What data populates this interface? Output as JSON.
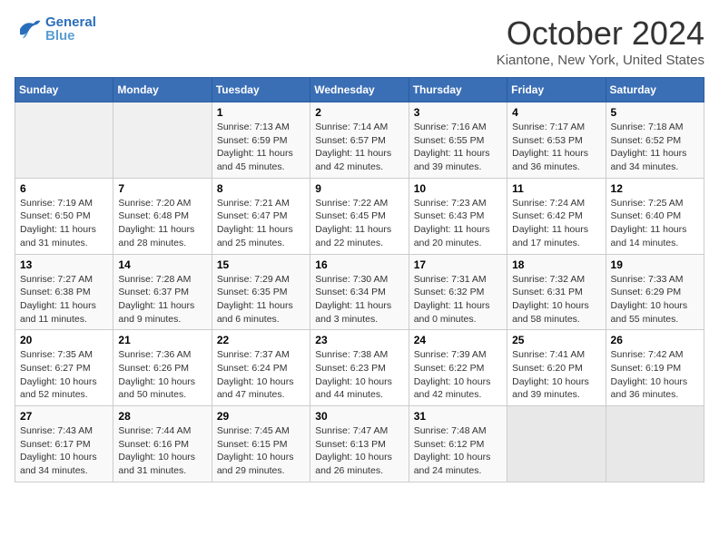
{
  "header": {
    "logo_line1": "General",
    "logo_line2": "Blue",
    "month": "October 2024",
    "location": "Kiantone, New York, United States"
  },
  "weekdays": [
    "Sunday",
    "Monday",
    "Tuesday",
    "Wednesday",
    "Thursday",
    "Friday",
    "Saturday"
  ],
  "weeks": [
    [
      {
        "day": "",
        "info": ""
      },
      {
        "day": "",
        "info": ""
      },
      {
        "day": "1",
        "info": "Sunrise: 7:13 AM\nSunset: 6:59 PM\nDaylight: 11 hours and 45 minutes."
      },
      {
        "day": "2",
        "info": "Sunrise: 7:14 AM\nSunset: 6:57 PM\nDaylight: 11 hours and 42 minutes."
      },
      {
        "day": "3",
        "info": "Sunrise: 7:16 AM\nSunset: 6:55 PM\nDaylight: 11 hours and 39 minutes."
      },
      {
        "day": "4",
        "info": "Sunrise: 7:17 AM\nSunset: 6:53 PM\nDaylight: 11 hours and 36 minutes."
      },
      {
        "day": "5",
        "info": "Sunrise: 7:18 AM\nSunset: 6:52 PM\nDaylight: 11 hours and 34 minutes."
      }
    ],
    [
      {
        "day": "6",
        "info": "Sunrise: 7:19 AM\nSunset: 6:50 PM\nDaylight: 11 hours and 31 minutes."
      },
      {
        "day": "7",
        "info": "Sunrise: 7:20 AM\nSunset: 6:48 PM\nDaylight: 11 hours and 28 minutes."
      },
      {
        "day": "8",
        "info": "Sunrise: 7:21 AM\nSunset: 6:47 PM\nDaylight: 11 hours and 25 minutes."
      },
      {
        "day": "9",
        "info": "Sunrise: 7:22 AM\nSunset: 6:45 PM\nDaylight: 11 hours and 22 minutes."
      },
      {
        "day": "10",
        "info": "Sunrise: 7:23 AM\nSunset: 6:43 PM\nDaylight: 11 hours and 20 minutes."
      },
      {
        "day": "11",
        "info": "Sunrise: 7:24 AM\nSunset: 6:42 PM\nDaylight: 11 hours and 17 minutes."
      },
      {
        "day": "12",
        "info": "Sunrise: 7:25 AM\nSunset: 6:40 PM\nDaylight: 11 hours and 14 minutes."
      }
    ],
    [
      {
        "day": "13",
        "info": "Sunrise: 7:27 AM\nSunset: 6:38 PM\nDaylight: 11 hours and 11 minutes."
      },
      {
        "day": "14",
        "info": "Sunrise: 7:28 AM\nSunset: 6:37 PM\nDaylight: 11 hours and 9 minutes."
      },
      {
        "day": "15",
        "info": "Sunrise: 7:29 AM\nSunset: 6:35 PM\nDaylight: 11 hours and 6 minutes."
      },
      {
        "day": "16",
        "info": "Sunrise: 7:30 AM\nSunset: 6:34 PM\nDaylight: 11 hours and 3 minutes."
      },
      {
        "day": "17",
        "info": "Sunrise: 7:31 AM\nSunset: 6:32 PM\nDaylight: 11 hours and 0 minutes."
      },
      {
        "day": "18",
        "info": "Sunrise: 7:32 AM\nSunset: 6:31 PM\nDaylight: 10 hours and 58 minutes."
      },
      {
        "day": "19",
        "info": "Sunrise: 7:33 AM\nSunset: 6:29 PM\nDaylight: 10 hours and 55 minutes."
      }
    ],
    [
      {
        "day": "20",
        "info": "Sunrise: 7:35 AM\nSunset: 6:27 PM\nDaylight: 10 hours and 52 minutes."
      },
      {
        "day": "21",
        "info": "Sunrise: 7:36 AM\nSunset: 6:26 PM\nDaylight: 10 hours and 50 minutes."
      },
      {
        "day": "22",
        "info": "Sunrise: 7:37 AM\nSunset: 6:24 PM\nDaylight: 10 hours and 47 minutes."
      },
      {
        "day": "23",
        "info": "Sunrise: 7:38 AM\nSunset: 6:23 PM\nDaylight: 10 hours and 44 minutes."
      },
      {
        "day": "24",
        "info": "Sunrise: 7:39 AM\nSunset: 6:22 PM\nDaylight: 10 hours and 42 minutes."
      },
      {
        "day": "25",
        "info": "Sunrise: 7:41 AM\nSunset: 6:20 PM\nDaylight: 10 hours and 39 minutes."
      },
      {
        "day": "26",
        "info": "Sunrise: 7:42 AM\nSunset: 6:19 PM\nDaylight: 10 hours and 36 minutes."
      }
    ],
    [
      {
        "day": "27",
        "info": "Sunrise: 7:43 AM\nSunset: 6:17 PM\nDaylight: 10 hours and 34 minutes."
      },
      {
        "day": "28",
        "info": "Sunrise: 7:44 AM\nSunset: 6:16 PM\nDaylight: 10 hours and 31 minutes."
      },
      {
        "day": "29",
        "info": "Sunrise: 7:45 AM\nSunset: 6:15 PM\nDaylight: 10 hours and 29 minutes."
      },
      {
        "day": "30",
        "info": "Sunrise: 7:47 AM\nSunset: 6:13 PM\nDaylight: 10 hours and 26 minutes."
      },
      {
        "day": "31",
        "info": "Sunrise: 7:48 AM\nSunset: 6:12 PM\nDaylight: 10 hours and 24 minutes."
      },
      {
        "day": "",
        "info": ""
      },
      {
        "day": "",
        "info": ""
      }
    ]
  ]
}
